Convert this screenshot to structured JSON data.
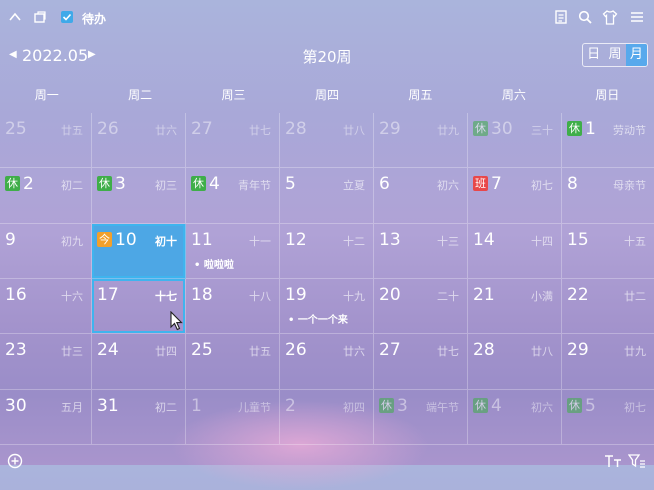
{
  "toolbar": {
    "todo_label": "待办",
    "todo_checked": true,
    "icons": [
      "collapse-icon",
      "window-icon",
      "notes-icon",
      "search-icon",
      "shirt-icon",
      "menu-icon"
    ]
  },
  "nav": {
    "month": "2022.05",
    "week": "第20周",
    "views": [
      {
        "label": "日",
        "active": false
      },
      {
        "label": "周",
        "active": false
      },
      {
        "label": "月",
        "active": true
      }
    ]
  },
  "weekdays": [
    "周一",
    "周二",
    "周三",
    "周四",
    "周五",
    "周六",
    "周日"
  ],
  "badge_colors": {
    "rest": "#3fae49",
    "work": "#e8474a",
    "today": "#f2a02b"
  },
  "cells": [
    {
      "day": "25",
      "lunar": "廿五",
      "faded": true
    },
    {
      "day": "26",
      "lunar": "廿六",
      "faded": true
    },
    {
      "day": "27",
      "lunar": "廿七",
      "faded": true
    },
    {
      "day": "28",
      "lunar": "廿八",
      "faded": true
    },
    {
      "day": "29",
      "lunar": "廿九",
      "faded": true
    },
    {
      "day": "30",
      "lunar": "三十",
      "faded": true,
      "badge": "休",
      "badge_type": "rest"
    },
    {
      "day": "1",
      "lunar": "劳动节",
      "badge": "休",
      "badge_type": "rest"
    },
    {
      "day": "2",
      "lunar": "初二",
      "badge": "休",
      "badge_type": "rest"
    },
    {
      "day": "3",
      "lunar": "初三",
      "badge": "休",
      "badge_type": "rest"
    },
    {
      "day": "4",
      "lunar": "青年节",
      "badge": "休",
      "badge_type": "rest"
    },
    {
      "day": "5",
      "lunar": "立夏"
    },
    {
      "day": "6",
      "lunar": "初六"
    },
    {
      "day": "7",
      "lunar": "初七",
      "badge": "班",
      "badge_type": "work"
    },
    {
      "day": "8",
      "lunar": "母亲节"
    },
    {
      "day": "9",
      "lunar": "初九"
    },
    {
      "day": "10",
      "lunar": "初十",
      "badge": "今",
      "badge_type": "today",
      "today": true
    },
    {
      "day": "11",
      "lunar": "十一",
      "event": "啦啦啦"
    },
    {
      "day": "12",
      "lunar": "十二"
    },
    {
      "day": "13",
      "lunar": "十三"
    },
    {
      "day": "14",
      "lunar": "十四"
    },
    {
      "day": "15",
      "lunar": "十五"
    },
    {
      "day": "16",
      "lunar": "十六"
    },
    {
      "day": "17",
      "lunar": "十七",
      "selected": true
    },
    {
      "day": "18",
      "lunar": "十八"
    },
    {
      "day": "19",
      "lunar": "十九",
      "event": "一个一个来"
    },
    {
      "day": "20",
      "lunar": "二十"
    },
    {
      "day": "21",
      "lunar": "小满"
    },
    {
      "day": "22",
      "lunar": "廿二"
    },
    {
      "day": "23",
      "lunar": "廿三"
    },
    {
      "day": "24",
      "lunar": "廿四"
    },
    {
      "day": "25",
      "lunar": "廿五"
    },
    {
      "day": "26",
      "lunar": "廿六"
    },
    {
      "day": "27",
      "lunar": "廿七"
    },
    {
      "day": "28",
      "lunar": "廿八"
    },
    {
      "day": "29",
      "lunar": "廿九"
    },
    {
      "day": "30",
      "lunar": "五月"
    },
    {
      "day": "31",
      "lunar": "初二"
    },
    {
      "day": "1",
      "lunar": "儿童节",
      "faded": true
    },
    {
      "day": "2",
      "lunar": "初四",
      "faded": true
    },
    {
      "day": "3",
      "lunar": "端午节",
      "faded": true,
      "badge": "休",
      "badge_type": "rest"
    },
    {
      "day": "4",
      "lunar": "初六",
      "faded": true,
      "badge": "休",
      "badge_type": "rest"
    },
    {
      "day": "5",
      "lunar": "初七",
      "faded": true,
      "badge": "休",
      "badge_type": "rest"
    }
  ],
  "bottom": {
    "icons": [
      "add-icon",
      "text-format-icon",
      "filter-icon"
    ]
  }
}
